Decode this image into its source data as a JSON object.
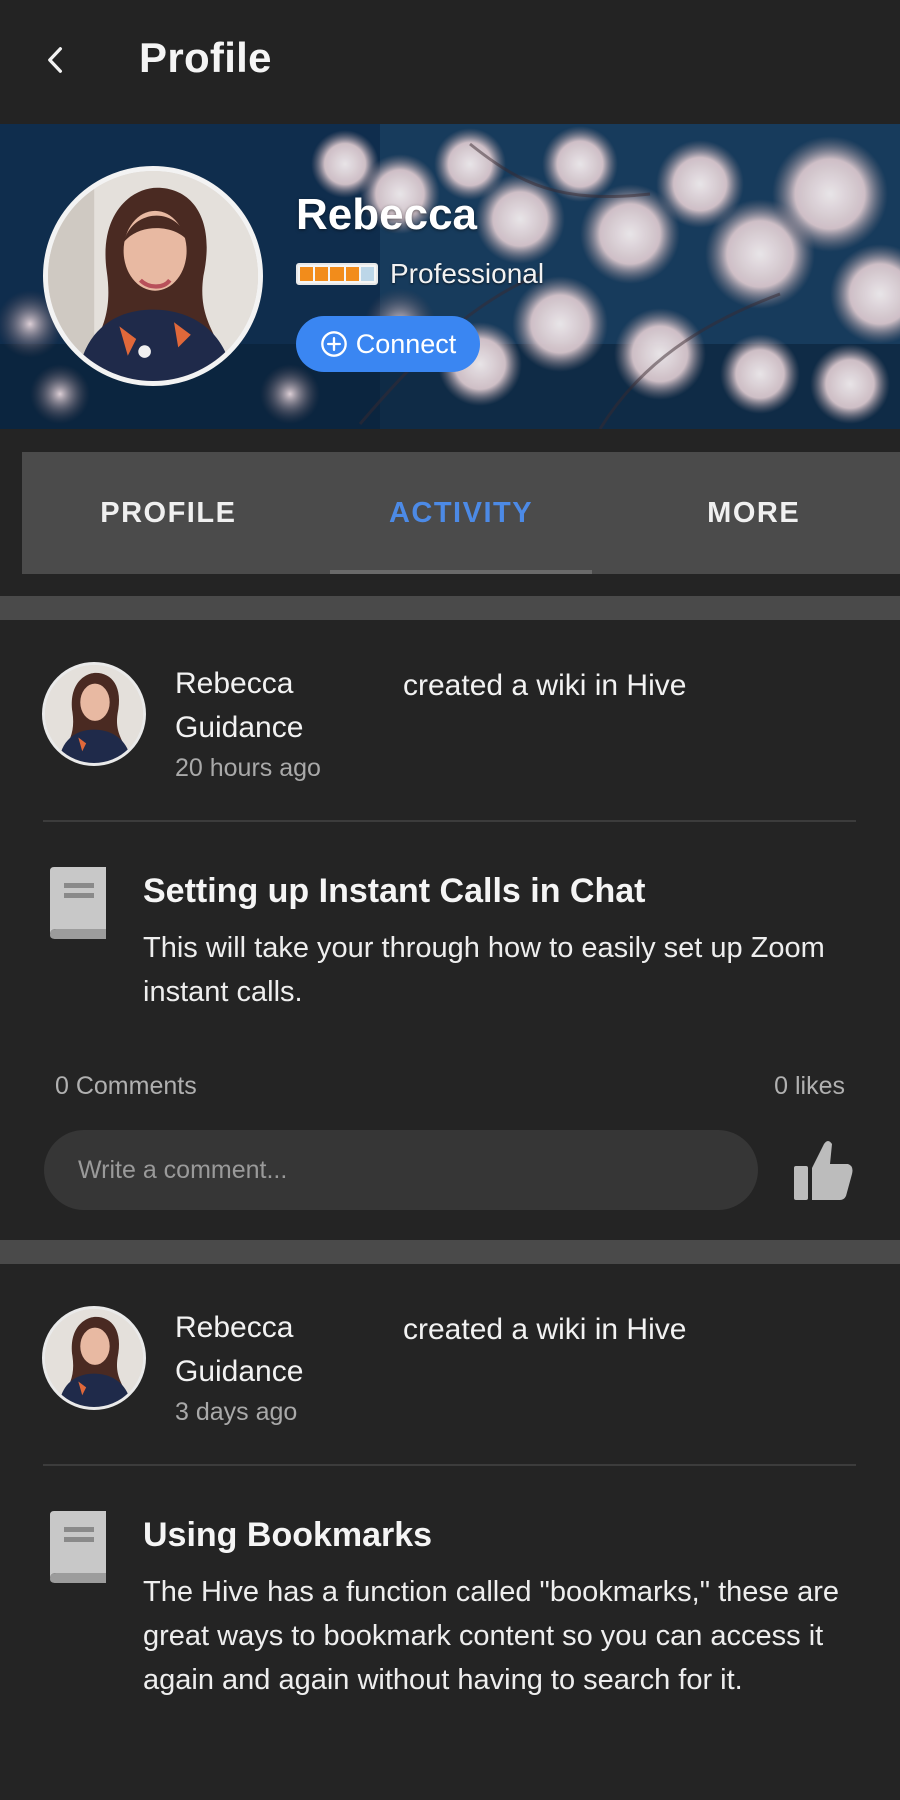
{
  "header": {
    "title": "Profile"
  },
  "profile": {
    "name": "Rebecca",
    "level_label": "Professional",
    "level": {
      "filled": 4,
      "total": 5
    },
    "connect_label": "Connect"
  },
  "tabs": [
    {
      "label": "PROFILE",
      "active": false
    },
    {
      "label": "ACTIVITY",
      "active": true
    },
    {
      "label": "MORE",
      "active": false
    }
  ],
  "activity": [
    {
      "user_first": "Rebecca",
      "user_last": "Guidance",
      "action": "created a wiki in Hive",
      "time": "20 hours ago",
      "wiki_title": "Setting up Instant Calls in Chat",
      "wiki_desc": "This will take your through how to easily set up Zoom instant calls.",
      "comments": "0 Comments",
      "likes": "0 likes",
      "comment_placeholder": "Write a comment..."
    },
    {
      "user_first": "Rebecca",
      "user_last": "Guidance",
      "action": "created a wiki in Hive",
      "time": "3 days ago",
      "wiki_title": "Using Bookmarks",
      "wiki_desc": "The Hive has a function called \"bookmarks,\" these are great ways to bookmark content so you can access it again and again without having to search for it."
    }
  ],
  "colors": {
    "background": "#242424",
    "accent": "#3a86f2",
    "active_tab": "#4c8ae6",
    "tab_bar": "#4b4b4b",
    "level_fill": "#f28c1b"
  },
  "icons": {
    "back": "chevron-left-icon",
    "connect": "plus-circle-icon",
    "wiki": "book-icon",
    "like": "thumbs-up-icon"
  }
}
